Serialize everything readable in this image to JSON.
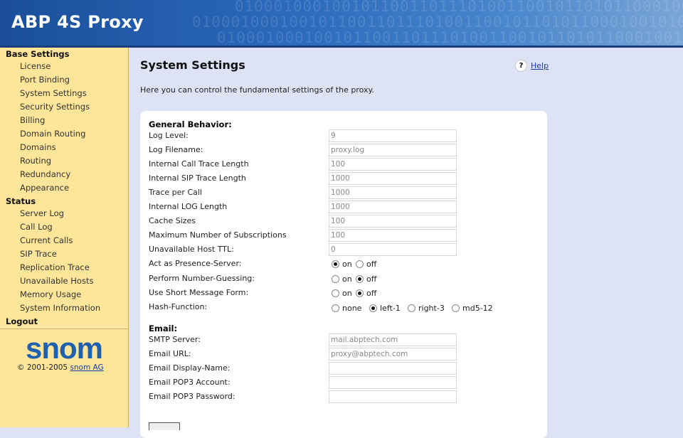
{
  "app_title": "ABP 4S Proxy",
  "header_pattern": "01000100010010110011011101001100101101011000100101011100010100010101000100101001001011000011100101001001010010101101011",
  "sidebar": {
    "groups": [
      {
        "label": "Base Settings",
        "items": [
          "License",
          "Port Binding",
          "System Settings",
          "Security Settings",
          "Billing",
          "Domain Routing",
          "Domains",
          "Routing",
          "Redundancy",
          "Appearance"
        ]
      },
      {
        "label": "Status",
        "items": [
          "Server Log",
          "Call Log",
          "Current Calls",
          "SIP Trace",
          "Replication Trace",
          "Unavailable Hosts",
          "Memory Usage",
          "System Information"
        ]
      },
      {
        "label": "Logout",
        "items": []
      }
    ],
    "logo_text": "snom",
    "copyright": "© 2001-2005",
    "copyright_link": "snom AG",
    "colors": {
      "background": "#fde59a",
      "logo": "#1e61b0"
    }
  },
  "main": {
    "title": "System Settings",
    "help_label": "Help",
    "help_icon": "?",
    "intro": "Here you can control the fundamental settings of the proxy.",
    "general": {
      "title": "General Behavior:",
      "fields": [
        {
          "label": "Log Level:",
          "value": "9"
        },
        {
          "label": "Log Filename:",
          "value": "proxy.log"
        },
        {
          "label": "Internal Call Trace Length",
          "value": "100"
        },
        {
          "label": "Internal SIP Trace Length",
          "value": "1000"
        },
        {
          "label": "Trace per Call",
          "value": "1000"
        },
        {
          "label": "Internal LOG Length",
          "value": "1000"
        },
        {
          "label": "Cache Sizes",
          "value": "100"
        },
        {
          "label": "Maximum Number of Subscriptions",
          "value": "100"
        },
        {
          "label": "Unavailable Host TTL:",
          "value": "0"
        }
      ],
      "radios": [
        {
          "label": "Act as Presence-Server:",
          "options": [
            "on",
            "off"
          ],
          "selected": "on"
        },
        {
          "label": "Perform Number-Guessing:",
          "options": [
            "on",
            "off"
          ],
          "selected": "off"
        },
        {
          "label": "Use Short Message Form:",
          "options": [
            "on",
            "off"
          ],
          "selected": "off"
        },
        {
          "label": "Hash-Function:",
          "options": [
            "none",
            "left-1",
            "right-3",
            "md5-12"
          ],
          "selected": "left-1"
        }
      ]
    },
    "email": {
      "title": "Email:",
      "fields": [
        {
          "label": "SMTP Server:",
          "value": "mail.abptech.com"
        },
        {
          "label": "Email URL:",
          "value": "proxy@abptech.com"
        },
        {
          "label": "Email Display-Name:",
          "value": ""
        },
        {
          "label": "Email POP3 Account:",
          "value": ""
        },
        {
          "label": "Email POP3 Password:",
          "value": ""
        }
      ]
    }
  },
  "colors": {
    "header": "#2d6bbd",
    "content_bg": "#dde3f4",
    "panel": "#ffffff",
    "link": "#1a3caa"
  }
}
